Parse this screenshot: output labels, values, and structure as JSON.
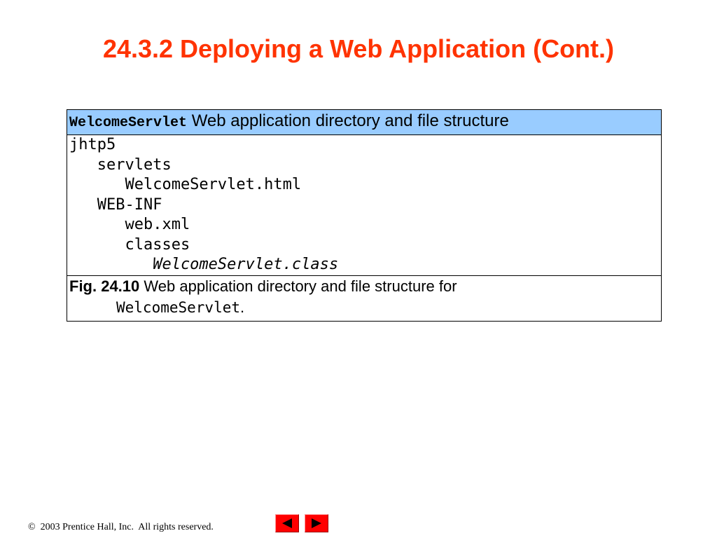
{
  "slide": {
    "title": "24.3.2 Deploying a Web Application (Cont.)"
  },
  "figure": {
    "header_code": "WelcomeServlet",
    "header_text": " Web application directory and file structure",
    "tree": [
      {
        "text": "jhtp5",
        "indent": "",
        "italic": false
      },
      {
        "text": "servlets",
        "indent": "   ",
        "italic": false
      },
      {
        "text": "WelcomeServlet.html",
        "indent": "      ",
        "italic": false
      },
      {
        "text": "WEB-INF",
        "indent": "   ",
        "italic": false
      },
      {
        "text": "web.xml",
        "indent": "      ",
        "italic": false
      },
      {
        "text": "classes",
        "indent": "      ",
        "italic": false
      },
      {
        "text": "WelcomeServlet.class",
        "indent": "         ",
        "italic": true
      }
    ],
    "caption_label": "Fig. 24.10",
    "caption_text": "   Web application directory and file structure for",
    "caption_code": "WelcomeServlet",
    "caption_end": "."
  },
  "footer": {
    "copyright": "©  2003 Prentice Hall, Inc.  All rights reserved."
  },
  "nav": {
    "prev_icon": "triangle-left-icon",
    "next_icon": "triangle-right-icon",
    "button_color": "#ff0000",
    "icon_color": "#000000"
  },
  "colors": {
    "title": "#ff3300",
    "header_bg": "#99ccff"
  }
}
